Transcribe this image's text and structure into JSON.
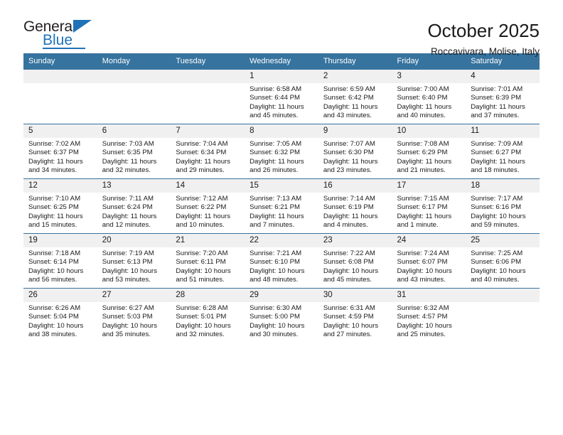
{
  "brand": {
    "name_top": "General",
    "name_bottom": "Blue",
    "colors": {
      "blue": "#2072b8",
      "dark": "#231f20"
    }
  },
  "header": {
    "title": "October 2025",
    "subtitle": "Roccavivara, Molise, Italy"
  },
  "theme": {
    "header_blue": "#36739e",
    "daynum_band": "#f0f0f0",
    "text": "#1a1a1a"
  },
  "weekdays": [
    "Sunday",
    "Monday",
    "Tuesday",
    "Wednesday",
    "Thursday",
    "Friday",
    "Saturday"
  ],
  "labels": {
    "sunrise_prefix": "Sunrise:",
    "sunset_prefix": "Sunset:",
    "daylight_prefix": "Daylight:"
  },
  "weeks": [
    [
      {
        "day": "",
        "blank": true
      },
      {
        "day": "",
        "blank": true
      },
      {
        "day": "",
        "blank": true
      },
      {
        "day": "1",
        "sunrise": "Sunrise: 6:58 AM",
        "sunset": "Sunset: 6:44 PM",
        "daylight_line1": "Daylight: 11 hours",
        "daylight_line2": "and 45 minutes."
      },
      {
        "day": "2",
        "sunrise": "Sunrise: 6:59 AM",
        "sunset": "Sunset: 6:42 PM",
        "daylight_line1": "Daylight: 11 hours",
        "daylight_line2": "and 43 minutes."
      },
      {
        "day": "3",
        "sunrise": "Sunrise: 7:00 AM",
        "sunset": "Sunset: 6:40 PM",
        "daylight_line1": "Daylight: 11 hours",
        "daylight_line2": "and 40 minutes."
      },
      {
        "day": "4",
        "sunrise": "Sunrise: 7:01 AM",
        "sunset": "Sunset: 6:39 PM",
        "daylight_line1": "Daylight: 11 hours",
        "daylight_line2": "and 37 minutes."
      }
    ],
    [
      {
        "day": "5",
        "sunrise": "Sunrise: 7:02 AM",
        "sunset": "Sunset: 6:37 PM",
        "daylight_line1": "Daylight: 11 hours",
        "daylight_line2": "and 34 minutes."
      },
      {
        "day": "6",
        "sunrise": "Sunrise: 7:03 AM",
        "sunset": "Sunset: 6:35 PM",
        "daylight_line1": "Daylight: 11 hours",
        "daylight_line2": "and 32 minutes."
      },
      {
        "day": "7",
        "sunrise": "Sunrise: 7:04 AM",
        "sunset": "Sunset: 6:34 PM",
        "daylight_line1": "Daylight: 11 hours",
        "daylight_line2": "and 29 minutes."
      },
      {
        "day": "8",
        "sunrise": "Sunrise: 7:05 AM",
        "sunset": "Sunset: 6:32 PM",
        "daylight_line1": "Daylight: 11 hours",
        "daylight_line2": "and 26 minutes."
      },
      {
        "day": "9",
        "sunrise": "Sunrise: 7:07 AM",
        "sunset": "Sunset: 6:30 PM",
        "daylight_line1": "Daylight: 11 hours",
        "daylight_line2": "and 23 minutes."
      },
      {
        "day": "10",
        "sunrise": "Sunrise: 7:08 AM",
        "sunset": "Sunset: 6:29 PM",
        "daylight_line1": "Daylight: 11 hours",
        "daylight_line2": "and 21 minutes."
      },
      {
        "day": "11",
        "sunrise": "Sunrise: 7:09 AM",
        "sunset": "Sunset: 6:27 PM",
        "daylight_line1": "Daylight: 11 hours",
        "daylight_line2": "and 18 minutes."
      }
    ],
    [
      {
        "day": "12",
        "sunrise": "Sunrise: 7:10 AM",
        "sunset": "Sunset: 6:25 PM",
        "daylight_line1": "Daylight: 11 hours",
        "daylight_line2": "and 15 minutes."
      },
      {
        "day": "13",
        "sunrise": "Sunrise: 7:11 AM",
        "sunset": "Sunset: 6:24 PM",
        "daylight_line1": "Daylight: 11 hours",
        "daylight_line2": "and 12 minutes."
      },
      {
        "day": "14",
        "sunrise": "Sunrise: 7:12 AM",
        "sunset": "Sunset: 6:22 PM",
        "daylight_line1": "Daylight: 11 hours",
        "daylight_line2": "and 10 minutes."
      },
      {
        "day": "15",
        "sunrise": "Sunrise: 7:13 AM",
        "sunset": "Sunset: 6:21 PM",
        "daylight_line1": "Daylight: 11 hours",
        "daylight_line2": "and 7 minutes."
      },
      {
        "day": "16",
        "sunrise": "Sunrise: 7:14 AM",
        "sunset": "Sunset: 6:19 PM",
        "daylight_line1": "Daylight: 11 hours",
        "daylight_line2": "and 4 minutes."
      },
      {
        "day": "17",
        "sunrise": "Sunrise: 7:15 AM",
        "sunset": "Sunset: 6:17 PM",
        "daylight_line1": "Daylight: 11 hours",
        "daylight_line2": "and 1 minute."
      },
      {
        "day": "18",
        "sunrise": "Sunrise: 7:17 AM",
        "sunset": "Sunset: 6:16 PM",
        "daylight_line1": "Daylight: 10 hours",
        "daylight_line2": "and 59 minutes."
      }
    ],
    [
      {
        "day": "19",
        "sunrise": "Sunrise: 7:18 AM",
        "sunset": "Sunset: 6:14 PM",
        "daylight_line1": "Daylight: 10 hours",
        "daylight_line2": "and 56 minutes."
      },
      {
        "day": "20",
        "sunrise": "Sunrise: 7:19 AM",
        "sunset": "Sunset: 6:13 PM",
        "daylight_line1": "Daylight: 10 hours",
        "daylight_line2": "and 53 minutes."
      },
      {
        "day": "21",
        "sunrise": "Sunrise: 7:20 AM",
        "sunset": "Sunset: 6:11 PM",
        "daylight_line1": "Daylight: 10 hours",
        "daylight_line2": "and 51 minutes."
      },
      {
        "day": "22",
        "sunrise": "Sunrise: 7:21 AM",
        "sunset": "Sunset: 6:10 PM",
        "daylight_line1": "Daylight: 10 hours",
        "daylight_line2": "and 48 minutes."
      },
      {
        "day": "23",
        "sunrise": "Sunrise: 7:22 AM",
        "sunset": "Sunset: 6:08 PM",
        "daylight_line1": "Daylight: 10 hours",
        "daylight_line2": "and 45 minutes."
      },
      {
        "day": "24",
        "sunrise": "Sunrise: 7:24 AM",
        "sunset": "Sunset: 6:07 PM",
        "daylight_line1": "Daylight: 10 hours",
        "daylight_line2": "and 43 minutes."
      },
      {
        "day": "25",
        "sunrise": "Sunrise: 7:25 AM",
        "sunset": "Sunset: 6:06 PM",
        "daylight_line1": "Daylight: 10 hours",
        "daylight_line2": "and 40 minutes."
      }
    ],
    [
      {
        "day": "26",
        "sunrise": "Sunrise: 6:26 AM",
        "sunset": "Sunset: 5:04 PM",
        "daylight_line1": "Daylight: 10 hours",
        "daylight_line2": "and 38 minutes."
      },
      {
        "day": "27",
        "sunrise": "Sunrise: 6:27 AM",
        "sunset": "Sunset: 5:03 PM",
        "daylight_line1": "Daylight: 10 hours",
        "daylight_line2": "and 35 minutes."
      },
      {
        "day": "28",
        "sunrise": "Sunrise: 6:28 AM",
        "sunset": "Sunset: 5:01 PM",
        "daylight_line1": "Daylight: 10 hours",
        "daylight_line2": "and 32 minutes."
      },
      {
        "day": "29",
        "sunrise": "Sunrise: 6:30 AM",
        "sunset": "Sunset: 5:00 PM",
        "daylight_line1": "Daylight: 10 hours",
        "daylight_line2": "and 30 minutes."
      },
      {
        "day": "30",
        "sunrise": "Sunrise: 6:31 AM",
        "sunset": "Sunset: 4:59 PM",
        "daylight_line1": "Daylight: 10 hours",
        "daylight_line2": "and 27 minutes."
      },
      {
        "day": "31",
        "sunrise": "Sunrise: 6:32 AM",
        "sunset": "Sunset: 4:57 PM",
        "daylight_line1": "Daylight: 10 hours",
        "daylight_line2": "and 25 minutes."
      },
      {
        "day": "",
        "blank": true
      }
    ]
  ]
}
